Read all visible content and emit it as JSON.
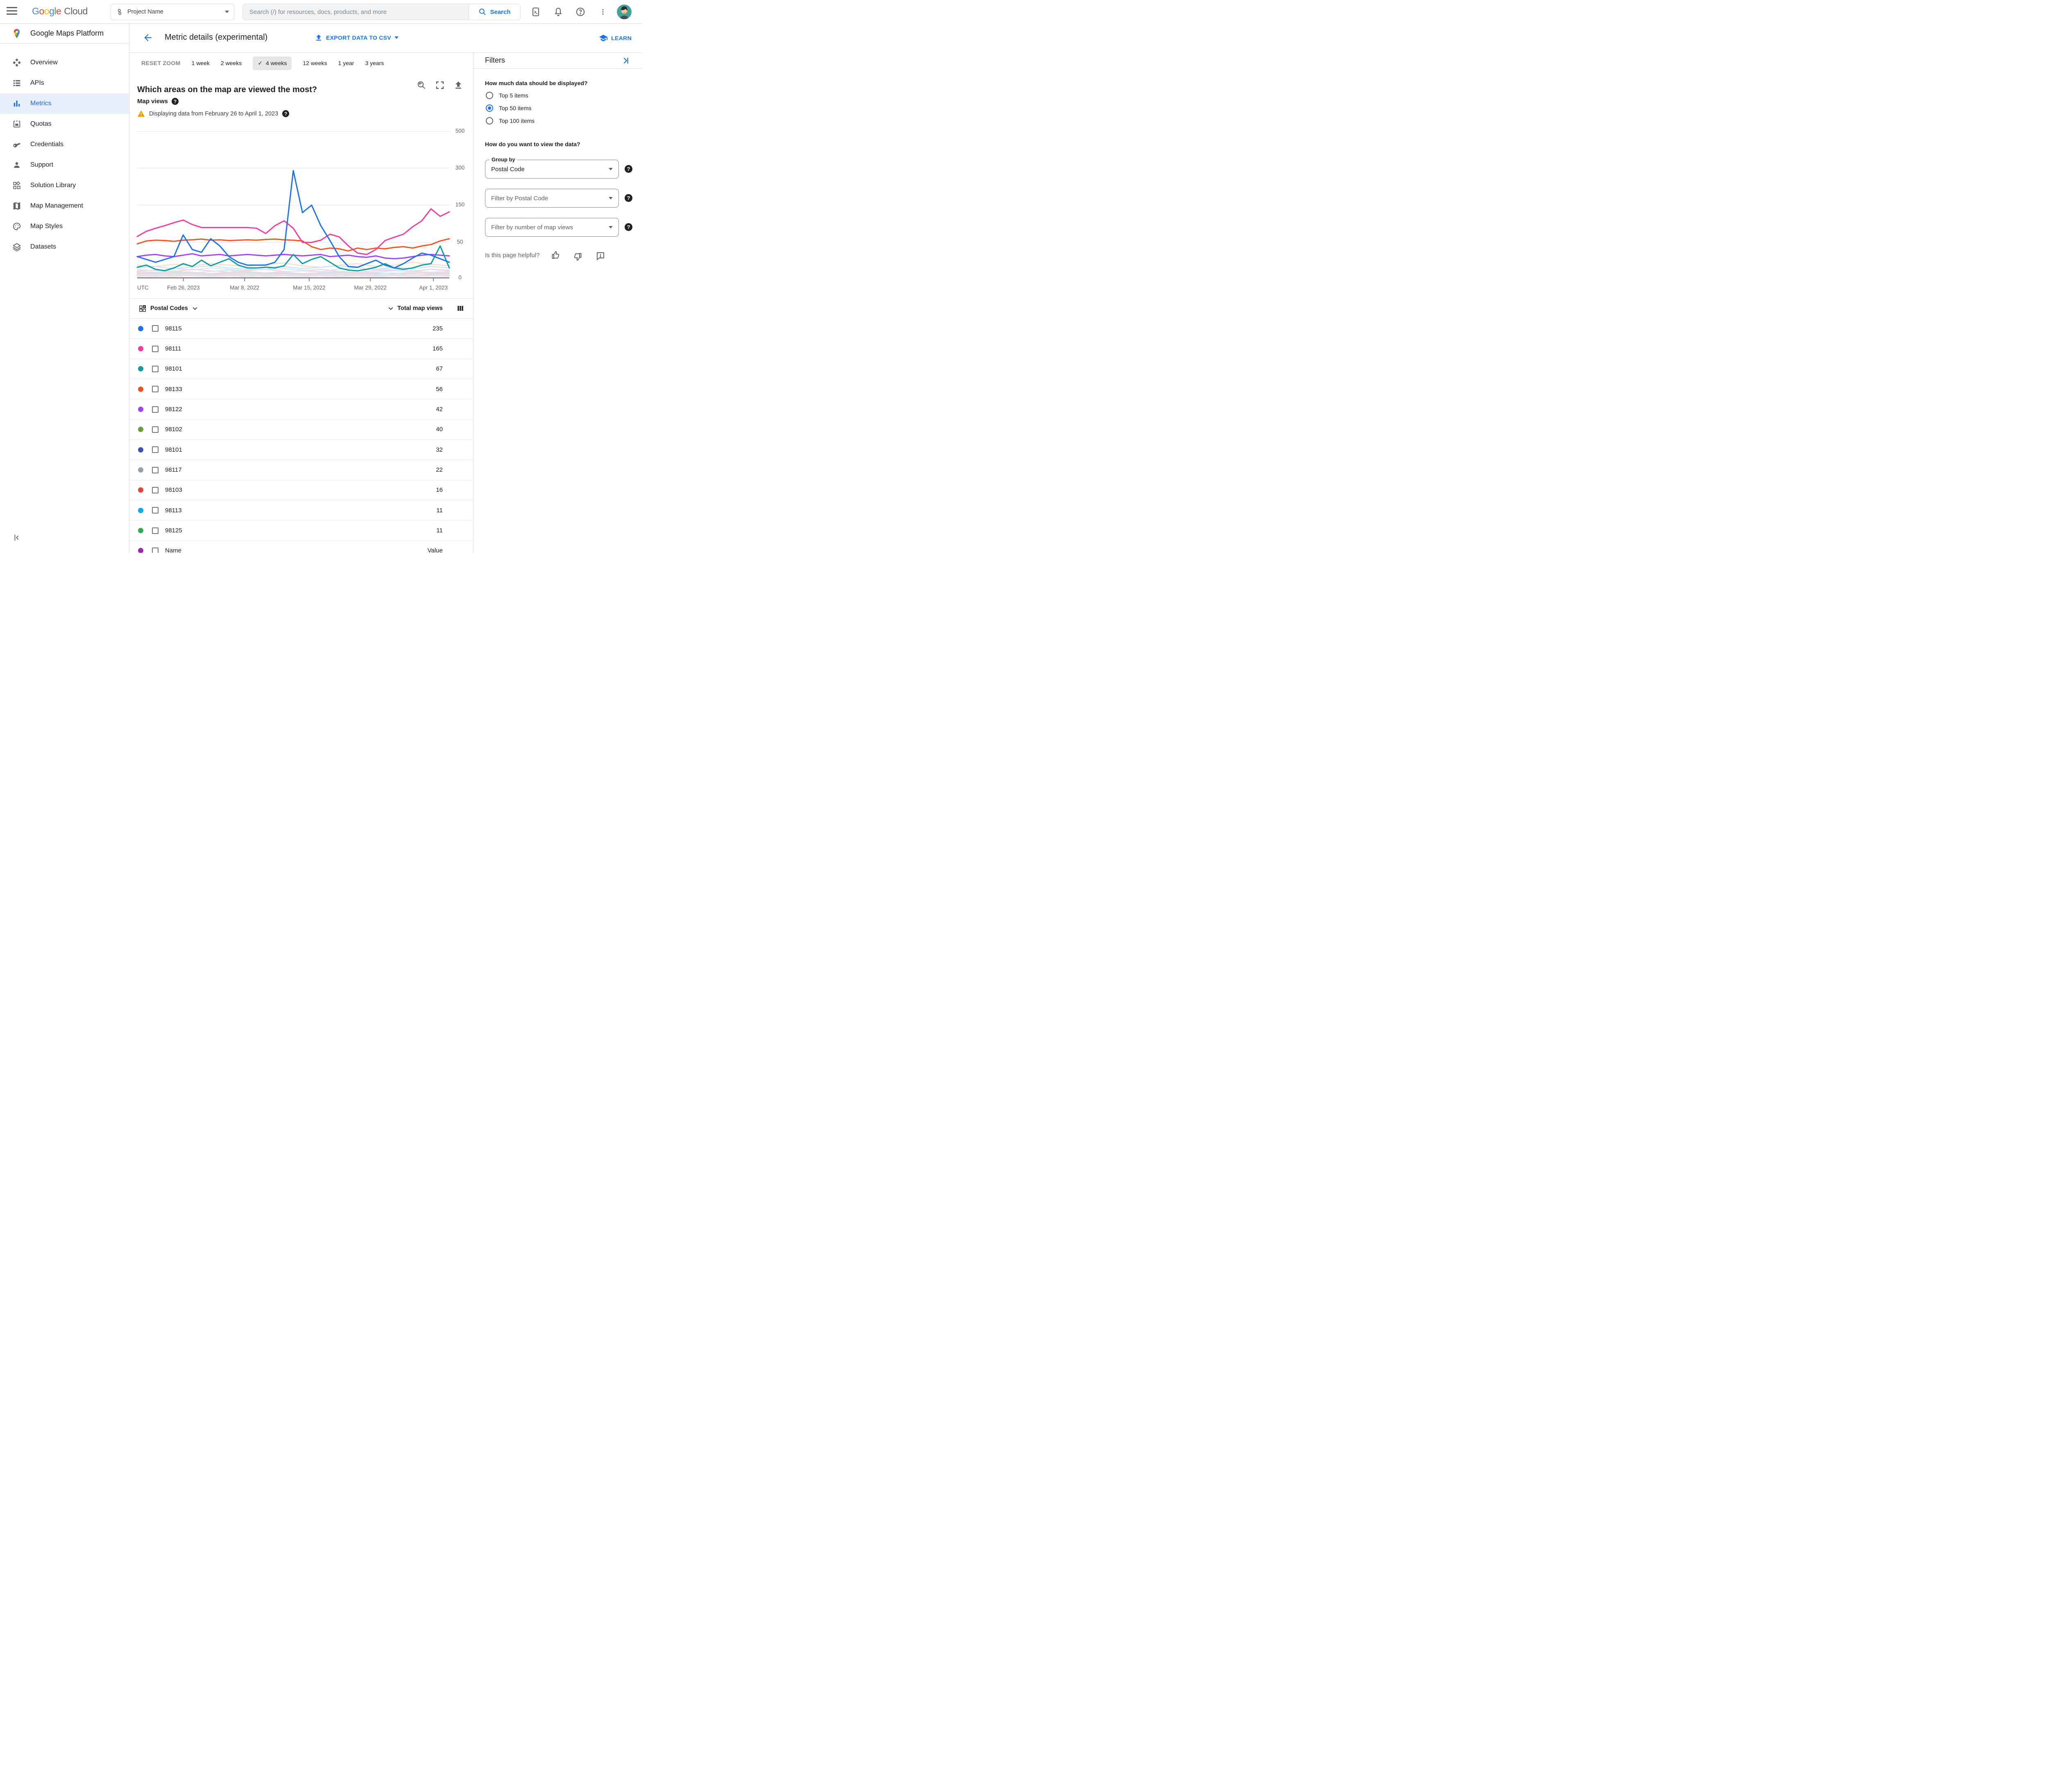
{
  "topbar": {
    "brand_google": "Google",
    "brand_cloud": "Cloud",
    "project_name": "Project Name",
    "search_placeholder": "Search (/) for resources, docs, products, and more",
    "search_button": "Search"
  },
  "sidebar": {
    "title": "Google Maps Platform",
    "items": [
      {
        "label": "Overview",
        "icon": "overview-icon",
        "active": false
      },
      {
        "label": "APIs",
        "icon": "apis-icon",
        "active": false
      },
      {
        "label": "Metrics",
        "icon": "metrics-icon",
        "active": true
      },
      {
        "label": "Quotas",
        "icon": "quotas-icon",
        "active": false
      },
      {
        "label": "Credentials",
        "icon": "key-icon",
        "active": false
      },
      {
        "label": "Support",
        "icon": "person-icon",
        "active": false
      },
      {
        "label": "Solution Library",
        "icon": "solution-library-icon",
        "active": false
      },
      {
        "label": "Map Management",
        "icon": "map-icon",
        "active": false
      },
      {
        "label": "Map Styles",
        "icon": "palette-icon",
        "active": false
      },
      {
        "label": "Datasets",
        "icon": "layers-icon",
        "active": false
      }
    ]
  },
  "header": {
    "title": "Metric details (experimental)",
    "export_label": "EXPORT DATA TO CSV",
    "learn_label": "LEARN"
  },
  "toolbar": {
    "reset_zoom": "RESET ZOOM",
    "tabs": [
      "1 week",
      "2 weeks",
      "4 weeks",
      "12 weeks",
      "1 year",
      "3 years"
    ],
    "selected_tab": "4 weeks",
    "checkmark": "✓"
  },
  "chart": {
    "title": "Which areas on the map are viewed the most?",
    "metric_label": "Map views",
    "warning_text": "Displaying data from February 26 to April 1, 2023"
  },
  "chart_data": {
    "type": "line",
    "title": "Which areas on the map are viewed the most?",
    "ylabel": "Map views",
    "grid": true,
    "legend_position": "table-below",
    "y_axis": {
      "tick_values": [
        0,
        50,
        150,
        300,
        500
      ],
      "scale": "nonlinear",
      "ylim": [
        0,
        500
      ]
    },
    "x_axis": {
      "timezone_label": "UTC",
      "tick_labels": [
        "Feb 26, 2023",
        "Mar 8, 2022",
        "Mar 15, 2022",
        "Mar 29, 2022",
        "Apr 1, 2023"
      ],
      "tick_fractions": [
        0.148,
        0.344,
        0.551,
        0.747,
        0.949
      ]
    },
    "series": [
      {
        "name": "98115",
        "color": "#1a73e8",
        "values": [
          30,
          26,
          22,
          26,
          30,
          70,
          40,
          36,
          60,
          45,
          30,
          22,
          18,
          18,
          18,
          22,
          40,
          290,
          130,
          150,
          95,
          55,
          30,
          16,
          15,
          20,
          25,
          18,
          14,
          20,
          28,
          35,
          32,
          27,
          22
        ]
      },
      {
        "name": "98111",
        "color": "#f23c9b",
        "values": [
          66,
          80,
          88,
          95,
          103,
          110,
          98,
          90,
          90,
          90,
          90,
          90,
          90,
          88,
          74,
          95,
          108,
          88,
          50,
          50,
          56,
          72,
          65,
          45,
          35,
          33,
          40,
          55,
          64,
          72,
          92,
          108,
          140,
          120,
          132
        ]
      },
      {
        "name": "98101",
        "color": "#0d9ba4",
        "values": [
          15,
          18,
          12,
          10,
          14,
          20,
          16,
          25,
          17,
          22,
          27,
          18,
          14,
          14,
          15,
          14,
          17,
          33,
          20,
          26,
          30,
          22,
          14,
          11,
          10,
          12,
          15,
          20,
          14,
          12,
          14,
          18,
          20,
          45,
          14
        ]
      },
      {
        "name": "98133",
        "color": "#f4511e",
        "values": [
          48,
          54,
          56,
          55,
          53,
          56,
          57,
          59,
          56,
          57,
          55,
          56,
          57,
          56,
          58,
          59,
          57,
          56,
          54,
          44,
          40,
          42,
          41,
          38,
          42,
          40,
          42,
          41,
          43,
          44,
          42,
          45,
          47,
          54,
          60
        ]
      },
      {
        "name": "98122",
        "color": "#a142f4",
        "values": [
          30,
          32,
          33,
          31,
          30,
          32,
          34,
          31,
          32,
          33,
          31,
          32,
          33,
          32,
          31,
          32,
          33,
          32,
          31,
          32,
          33,
          30,
          31,
          32,
          30,
          29,
          31,
          28,
          27,
          28,
          30,
          32,
          33,
          32,
          31
        ]
      }
    ],
    "muted_series": [
      {
        "color": "#f9dcc4",
        "values": [
          18,
          16,
          19,
          17,
          20,
          18,
          16,
          19,
          21,
          17,
          15,
          18,
          20,
          16,
          18,
          22,
          19,
          17
        ]
      },
      {
        "color": "#c8e6f5",
        "values": [
          14,
          16,
          13,
          15,
          17,
          14,
          12,
          15,
          16,
          13,
          15,
          17,
          14,
          12,
          15,
          13,
          16,
          14
        ]
      },
      {
        "color": "#cdeef2",
        "values": [
          12,
          10,
          13,
          11,
          14,
          12,
          10,
          12,
          13,
          11,
          9,
          12,
          14,
          11,
          13,
          10,
          12,
          11
        ]
      },
      {
        "color": "#f9cfe3",
        "values": [
          10,
          11,
          9,
          12,
          10,
          8,
          11,
          12,
          9,
          10,
          12,
          9,
          8,
          10,
          11,
          9,
          12,
          10
        ]
      },
      {
        "color": "#dbe3fa",
        "values": [
          9,
          8,
          10,
          7,
          9,
          11,
          8,
          7,
          9,
          10,
          8,
          9,
          7,
          8,
          10,
          9,
          8,
          9
        ]
      },
      {
        "color": "#f6d5cc",
        "values": [
          8,
          7,
          9,
          8,
          6,
          8,
          9,
          7,
          8,
          6,
          7,
          9,
          8,
          7,
          6,
          8,
          7,
          8
        ]
      },
      {
        "color": "#c5ecf6",
        "values": [
          7,
          6,
          8,
          7,
          5,
          7,
          8,
          6,
          7,
          5,
          6,
          8,
          7,
          6,
          7,
          5,
          6,
          7
        ]
      },
      {
        "color": "#f3d1d8",
        "values": [
          6,
          5,
          7,
          6,
          4,
          6,
          7,
          5,
          6,
          4,
          5,
          7,
          6,
          5,
          4,
          6,
          5,
          6
        ]
      },
      {
        "color": "#d9e7fb",
        "values": [
          5,
          4,
          6,
          5,
          3,
          5,
          6,
          4,
          5,
          3,
          4,
          6,
          5,
          4,
          5,
          3,
          4,
          5
        ]
      },
      {
        "color": "#f8e0ce",
        "values": [
          4,
          3,
          5,
          4,
          2,
          4,
          5,
          3,
          4,
          2,
          3,
          5,
          4,
          3,
          4,
          2,
          3,
          4
        ]
      },
      {
        "color": "#cfe8e9",
        "values": [
          3,
          2,
          4,
          3,
          2,
          3,
          4,
          2,
          3,
          2,
          3,
          4,
          3,
          2,
          3,
          2,
          3,
          3
        ]
      },
      {
        "color": "#f6d9ef",
        "values": [
          2,
          3,
          2,
          4,
          2,
          3,
          2,
          3,
          4,
          2,
          3,
          2,
          3,
          4,
          3,
          2,
          4,
          2
        ]
      }
    ]
  },
  "table": {
    "group_header": "Postal Codes",
    "value_header": "Total map views",
    "rows": [
      {
        "code": "98115",
        "views": "235",
        "color": "#1a73e8"
      },
      {
        "code": "98111",
        "views": "165",
        "color": "#f23c9b"
      },
      {
        "code": "98101",
        "views": "67",
        "color": "#0d9ba4"
      },
      {
        "code": "98133",
        "views": "56",
        "color": "#f4511e"
      },
      {
        "code": "98122",
        "views": "42",
        "color": "#a142f4"
      },
      {
        "code": "98102",
        "views": "40",
        "color": "#689f38"
      },
      {
        "code": "98101",
        "views": "32",
        "color": "#3f51b5"
      },
      {
        "code": "98117",
        "views": "22",
        "color": "#9aa0a6"
      },
      {
        "code": "98103",
        "views": "16",
        "color": "#ea4335"
      },
      {
        "code": "98113",
        "views": "11",
        "color": "#03a9f4"
      },
      {
        "code": "98125",
        "views": "11",
        "color": "#34a853"
      },
      {
        "code": "Name",
        "views": "Value",
        "color": "#9c27b0"
      }
    ]
  },
  "filters": {
    "title": "Filters",
    "q1": "How much data should be displayed?",
    "options": [
      {
        "label": "Top 5 items",
        "selected": false
      },
      {
        "label": "Top 50 items",
        "selected": true
      },
      {
        "label": "Top 100 items",
        "selected": false
      }
    ],
    "q2": "How do you want to view the data?",
    "group_by_label": "Group by",
    "group_by_value": "Postal Code",
    "filter_postal_placeholder": "Filter by Postal Code",
    "filter_views_placeholder": "Filter by number of map views",
    "helpful_text": "Is this page helpful?"
  }
}
